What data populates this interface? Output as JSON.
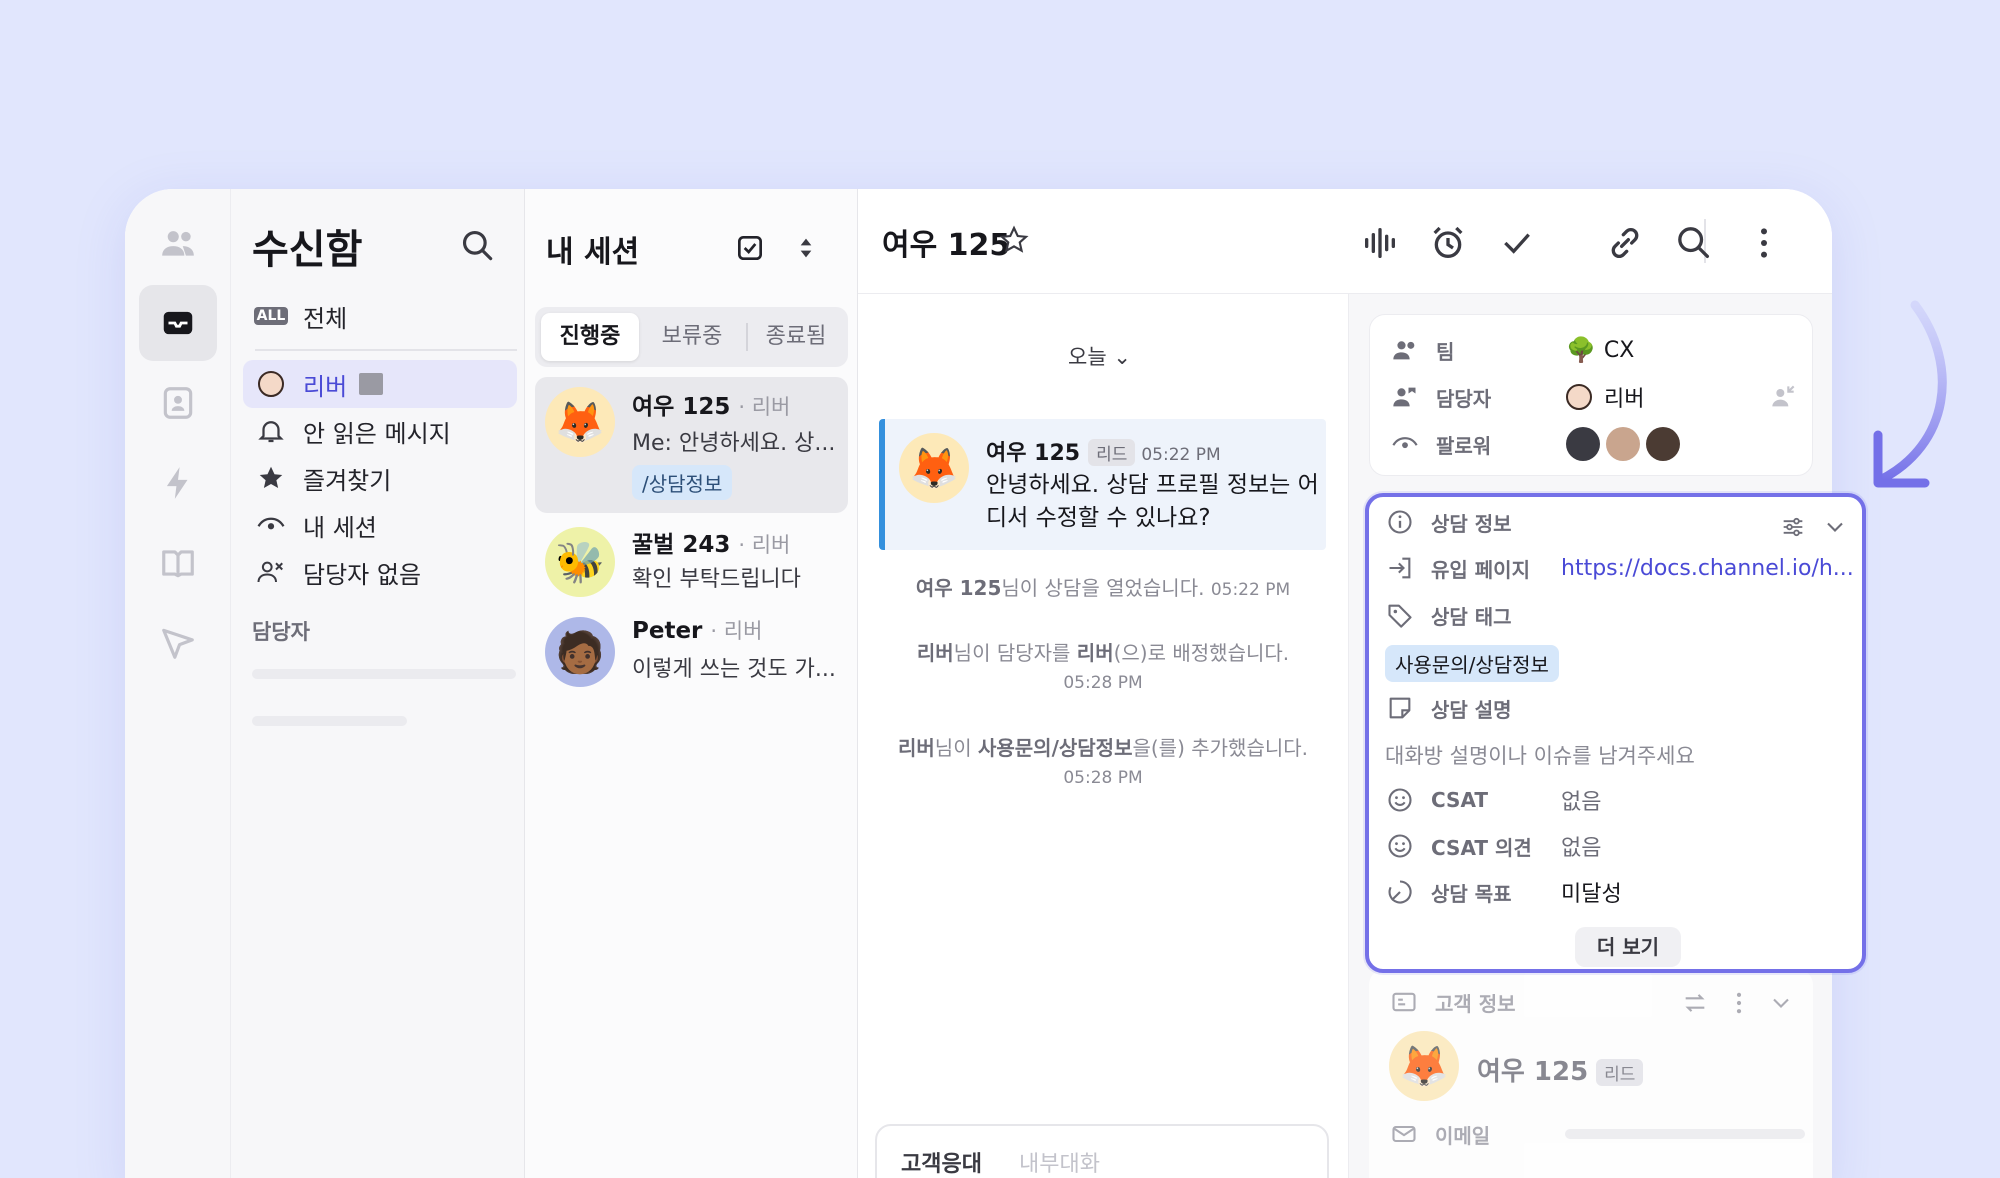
{
  "inbox": {
    "title": "수신함",
    "nav": [
      "전체",
      "리버",
      "안 읽은 메시지",
      "즐겨찾기",
      "내 세션",
      "담당자 없음"
    ],
    "all_badge": "ALL",
    "assignee_section": "담당자"
  },
  "sessions": {
    "title": "내 세션",
    "tabs": [
      "진행중",
      "보류중",
      "종료됨"
    ],
    "items": [
      {
        "name": "여우 125",
        "assignee": "· 리버",
        "message": "Me: 안녕하세요. 상...",
        "tag": "/상담정보",
        "avatar": "🦊"
      },
      {
        "name": "꿀벌 243",
        "assignee": "· 리버",
        "message": "확인 부탁드립니다",
        "avatar": "🐝"
      },
      {
        "name": "Peter",
        "assignee": "· 리버",
        "message": "이렇게 쓰는 것도 가...",
        "avatar": "🧑🏾"
      }
    ]
  },
  "chat": {
    "title": "여우 125",
    "date_divider": "오늘",
    "message": {
      "name": "여우 125",
      "badge": "리드",
      "time": "05:22 PM",
      "text": "안녕하세요. 상담 프로필 정보는 어디서 수정할 수 있나요?"
    },
    "events": [
      {
        "actor": "여우 125",
        "text": "님이 상담을 열었습니다.",
        "time": "05:22 PM"
      },
      {
        "actor": "리버",
        "mid": "님이 담당자를 ",
        "target": "리버",
        "text": "(으)로 배정했습니다.",
        "time": "05:28 PM"
      },
      {
        "actor": "리버",
        "mid": "님이 ",
        "target": "사용문의/상담정보",
        "text": "을(를) 추가했습니다.",
        "time": "05:28 PM"
      }
    ],
    "composer_tabs": [
      "고객응대",
      "내부대화"
    ]
  },
  "side": {
    "team_label": "팀",
    "team_value": "CX",
    "assignee_label": "담당자",
    "assignee_value": "리버",
    "follower_label": "팔로워",
    "info": {
      "title": "상담 정보",
      "page_label": "유입 페이지",
      "page_value": "https://docs.channel.io/h...",
      "tag_label": "상담 태그",
      "tag_value": "사용문의/상담정보",
      "desc_label": "상담 설명",
      "desc_placeholder": "대화방 설명이나 이슈를 남겨주세요",
      "csat_label": "CSAT",
      "csat_value": "없음",
      "csat_comment_label": "CSAT 의견",
      "csat_comment_value": "없음",
      "goal_label": "상담 목표",
      "goal_value": "미달성",
      "more": "더 보기"
    },
    "customer": {
      "title": "고객 정보",
      "name": "여우 125",
      "badge": "리드",
      "email_label": "이메일"
    }
  },
  "colors": {
    "accent": "#4a4ad6",
    "highlight_border": "#7470e8",
    "message_bar": "#3490dd",
    "background": "#e1e6fd"
  }
}
